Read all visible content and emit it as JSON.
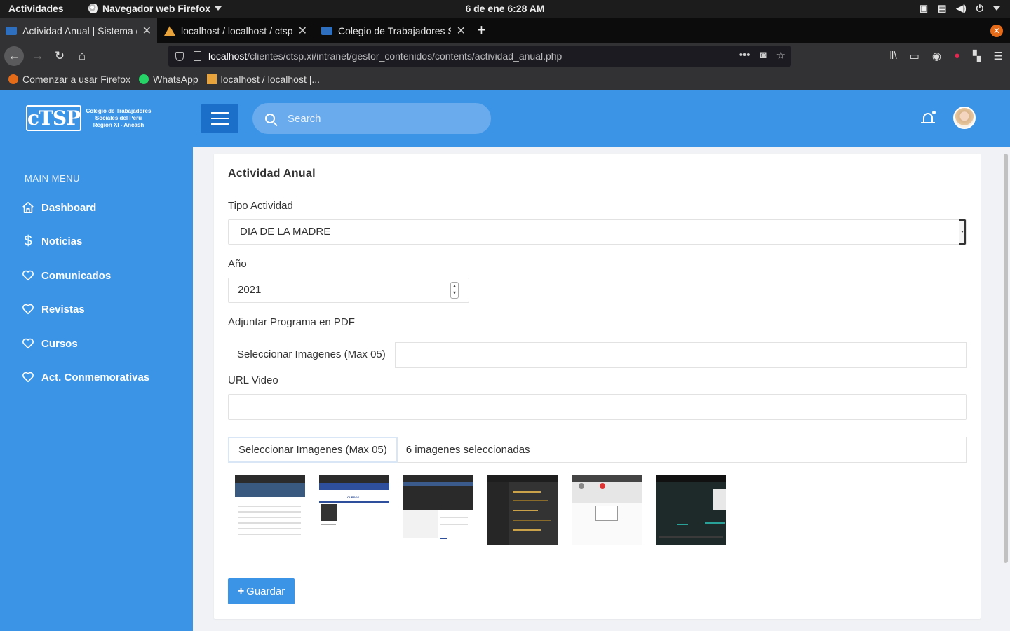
{
  "system": {
    "activities": "Actividades",
    "app_menu": "Navegador web Firefox",
    "clock": "6 de ene  6:28 AM"
  },
  "browser": {
    "tabs": [
      {
        "title": "Actividad Anual | Sistema d"
      },
      {
        "title": "localhost / localhost / ctsp"
      },
      {
        "title": "Colegio de Trabajadores So"
      }
    ],
    "url_host": "localhost",
    "url_path": "/clientes/ctsp.xi/intranet/gestor_contenidos/contents/actividad_anual.php",
    "bookmarks": [
      {
        "label": "Comenzar a usar Firefox"
      },
      {
        "label": "WhatsApp"
      },
      {
        "label": "localhost / localhost |..."
      }
    ]
  },
  "header": {
    "logo_mark": "cTSP",
    "logo_text": [
      "Colegio de Trabajadores",
      "Sociales del Perú",
      "Región XI - Ancash"
    ],
    "search_placeholder": "Search"
  },
  "sidebar": {
    "heading": "MAIN MENU",
    "items": [
      {
        "label": "Dashboard",
        "icon": "home-icon"
      },
      {
        "label": "Noticias",
        "icon": "dollar-icon"
      },
      {
        "label": "Comunicados",
        "icon": "heart-icon"
      },
      {
        "label": "Revistas",
        "icon": "heart-icon"
      },
      {
        "label": "Cursos",
        "icon": "heart-icon"
      },
      {
        "label": "Act. Conmemorativas",
        "icon": "heart-icon"
      }
    ]
  },
  "form": {
    "title": "Actividad Anual",
    "tipo_label": "Tipo Actividad",
    "tipo_value": "DIA DE LA MADRE",
    "anio_label": "Año",
    "anio_value": "2021",
    "pdf_label": "Adjuntar Programa en PDF",
    "pdf_button": "Seleccionar Imagenes (Max 05)",
    "pdf_filename": "",
    "video_label": "URL Video",
    "video_value": "",
    "images_button": "Seleccionar Imagenes (Max 05)",
    "images_status": "6 imagenes seleccionadas",
    "thumbnail_count": 6,
    "save_label": "Guardar"
  },
  "colors": {
    "primary": "#3c94e7",
    "primary_dark": "#1c6fc8",
    "background": "#f0f2f5"
  }
}
